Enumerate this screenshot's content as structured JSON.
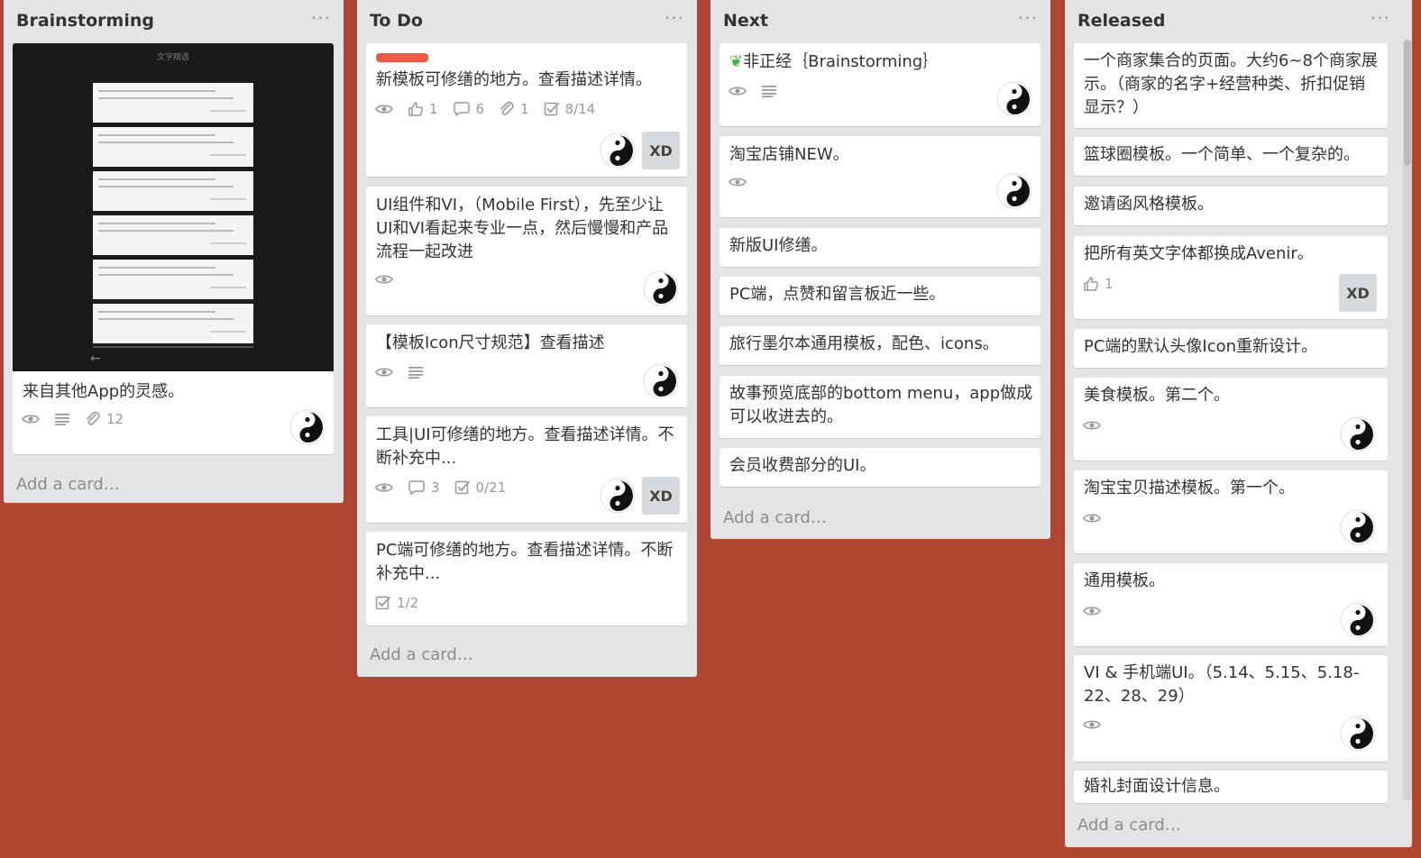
{
  "colors": {
    "board_bg": "#b04632",
    "list_bg": "#e2e4e6",
    "label_red": "#eb5a46"
  },
  "lists": [
    {
      "title": "Brainstorming",
      "menu": "···",
      "add_card": "Add a card…",
      "cards": [
        {
          "title": "来自其他App的灵感。",
          "cover_title": "文字精选",
          "badges": {
            "attachments": "12"
          }
        }
      ]
    },
    {
      "title": "To Do",
      "menu": "···",
      "add_card": "Add a card…",
      "cards": [
        {
          "title": "新模板可修缮的地方。查看描述详情。",
          "badges": {
            "likes": "1",
            "comments": "6",
            "attachments": "1",
            "checklist": "8/14"
          },
          "tag": "XD"
        },
        {
          "title": "UI组件和VI，（Mobile First），先至少让UI和VI看起来专业一点，然后慢慢和产品流程一起改进"
        },
        {
          "title": "【模板Icon尺寸规范】查看描述"
        },
        {
          "title": "工具|UI可修缮的地方。查看描述详情。不断补充中...",
          "badges": {
            "comments": "3",
            "checklist": "0/21"
          },
          "tag": "XD"
        },
        {
          "title": "PC端可修缮的地方。查看描述详情。不断补充中...",
          "badges": {
            "checklist": "1/2"
          }
        }
      ]
    },
    {
      "title": "Next",
      "menu": "···",
      "add_card": "Add a card…",
      "cards": [
        {
          "title": "非正经｛Brainstorming｝"
        },
        {
          "title": "淘宝店铺NEW。"
        },
        {
          "title": "新版UI修缮。"
        },
        {
          "title": "PC端，点赞和留言板近一些。"
        },
        {
          "title": "旅行墨尔本通用模板，配色、icons。"
        },
        {
          "title": "故事预览底部的bottom menu，app做成可以收进去的。"
        },
        {
          "title": "会员收费部分的UI。"
        }
      ]
    },
    {
      "title": "Released",
      "menu": "···",
      "add_card": "Add a card…",
      "cards": [
        {
          "title": "一个商家集合的页面。大约6~8个商家展示。（商家的名字+经营种类、折扣促销显示？）"
        },
        {
          "title": "篮球圈模板。一个简单、一个复杂的。"
        },
        {
          "title": "邀请函风格模板。"
        },
        {
          "title": "把所有英文字体都换成Avenir。",
          "badges": {
            "likes": "1"
          },
          "tag": "XD"
        },
        {
          "title": "PC端的默认头像Icon重新设计。"
        },
        {
          "title": "美食模板。第二个。"
        },
        {
          "title": "淘宝宝贝描述模板。第一个。"
        },
        {
          "title": "通用模板。"
        },
        {
          "title": "VI & 手机端UI。（5.14、5.15、5.18-22、28、29）"
        },
        {
          "title": "婚礼封面设计信息。"
        }
      ]
    }
  ]
}
